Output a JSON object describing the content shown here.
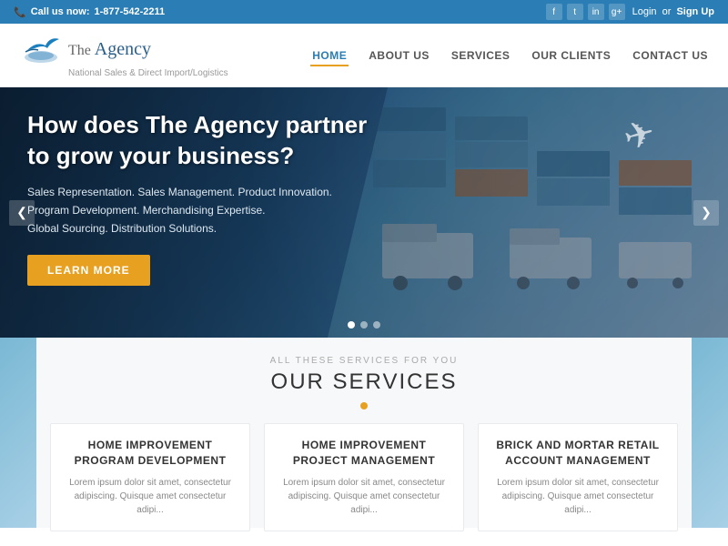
{
  "topbar": {
    "phone_label": "Call us now:",
    "phone_number": "1-877-542-2211",
    "auth_login": "Login",
    "auth_separator": "or",
    "auth_signup": "Sign Up",
    "social": [
      "f",
      "t",
      "in",
      "g+"
    ]
  },
  "header": {
    "logo_name": "The Agency",
    "logo_tagline": "National Sales & Direct Import/Logistics",
    "nav": [
      {
        "label": "HOME",
        "active": true
      },
      {
        "label": "ABOUT US",
        "active": false
      },
      {
        "label": "SERVICES",
        "active": false
      },
      {
        "label": "OUR CLIENTS",
        "active": false
      },
      {
        "label": "CONTACT US",
        "active": false
      }
    ]
  },
  "hero": {
    "heading_line1": "How does The Agency partner",
    "heading_line2": "to grow your business?",
    "subtitle_line1": "Sales Representation. Sales Management. Product Innovation.",
    "subtitle_line2": "Program Development. Merchandising Expertise.",
    "subtitle_line3": "Global Sourcing. Distribution Solutions.",
    "cta_button": "LEARN MORE",
    "prev_arrow": "❮",
    "next_arrow": "❯"
  },
  "services": {
    "subtitle": "ALL THESE SERVICES FOR YOU",
    "title": "OUR SERVICES",
    "divider_color": "#e8a020",
    "cards": [
      {
        "title": "HOME IMPROVEMENT PROGRAM DEVELOPMENT",
        "body": "Lorem ipsum dolor sit amet, consectetur adipiscing. Quisque amet consectetur adipi..."
      },
      {
        "title": "HOME IMPROVEMENT PROJECT MANAGEMENT",
        "body": "Lorem ipsum dolor sit amet, consectetur adipiscing. Quisque amet consectetur adipi..."
      },
      {
        "title": "BRICK AND MORTAR RETAIL ACCOUNT MANAGEMENT",
        "body": "Lorem ipsum dolor sit amet, consectetur adipiscing. Quisque amet consectetur adipi..."
      }
    ]
  }
}
